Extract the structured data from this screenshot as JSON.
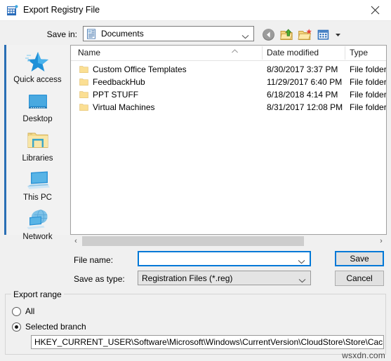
{
  "window": {
    "title": "Export Registry File",
    "icon": "registry-editor-icon",
    "close_label": "✕"
  },
  "savein": {
    "label": "Save in:",
    "value": "Documents",
    "icon": "documents-folder-icon",
    "chevron": "chevron-down-icon"
  },
  "toolbar": {
    "buttons": [
      {
        "name": "back-button",
        "icon": "back-arrow-icon",
        "tooltip": "Back"
      },
      {
        "name": "up-one-level-button",
        "icon": "up-folder-icon",
        "tooltip": "Up One Level"
      },
      {
        "name": "new-folder-button",
        "icon": "new-folder-icon",
        "tooltip": "Create New Folder"
      },
      {
        "name": "views-button",
        "icon": "views-icon",
        "tooltip": "Views"
      }
    ],
    "views_arrow": "dropdown-arrow-icon"
  },
  "places": [
    {
      "label": "Quick access",
      "icon": "quick-access-star-icon"
    },
    {
      "label": "Desktop",
      "icon": "desktop-icon"
    },
    {
      "label": "Libraries",
      "icon": "libraries-folder-icon"
    },
    {
      "label": "This PC",
      "icon": "this-pc-monitor-icon"
    },
    {
      "label": "Network",
      "icon": "network-globe-icon"
    }
  ],
  "filelist": {
    "columns": [
      "Name",
      "Date modified",
      "Type"
    ],
    "sort_indicator": "sort-ascending-icon",
    "rows": [
      {
        "name": "Custom Office Templates",
        "date": "8/30/2017 3:37 PM",
        "type": "File folder",
        "icon": "folder-icon"
      },
      {
        "name": "FeedbackHub",
        "date": "11/29/2017 6:40 PM",
        "type": "File folder",
        "icon": "folder-icon"
      },
      {
        "name": "PPT STUFF",
        "date": "6/18/2018 4:14 PM",
        "type": "File folder",
        "icon": "folder-icon"
      },
      {
        "name": "Virtual Machines",
        "date": "8/31/2017 12:08 PM",
        "type": "File folder",
        "icon": "folder-icon"
      }
    ]
  },
  "scrollbar": {
    "left_arrow": "‹",
    "right_arrow": "›"
  },
  "form": {
    "filename_label": "File name:",
    "filename_value": "",
    "filename_placeholder": "",
    "savetype_label": "Save as type:",
    "savetype_value": "Registration Files (*.reg)",
    "save_label": "Save",
    "cancel_label": "Cancel"
  },
  "export_range": {
    "group_label": "Export range",
    "options": [
      {
        "label": "All",
        "selected": false
      },
      {
        "label": "Selected branch",
        "selected": true
      }
    ],
    "branch_path": "HKEY_CURRENT_USER\\Software\\Microsoft\\Windows\\CurrentVersion\\CloudStore\\Store\\Cache\\Def"
  },
  "watermark": "wsxdn.com",
  "colors": {
    "accent": "#0078d7",
    "places_stripe": "#2a6fb5",
    "dialog_bg": "#f0f0f0",
    "list_bg": "#ffffff",
    "folder_yellow": "#fbdf93"
  }
}
